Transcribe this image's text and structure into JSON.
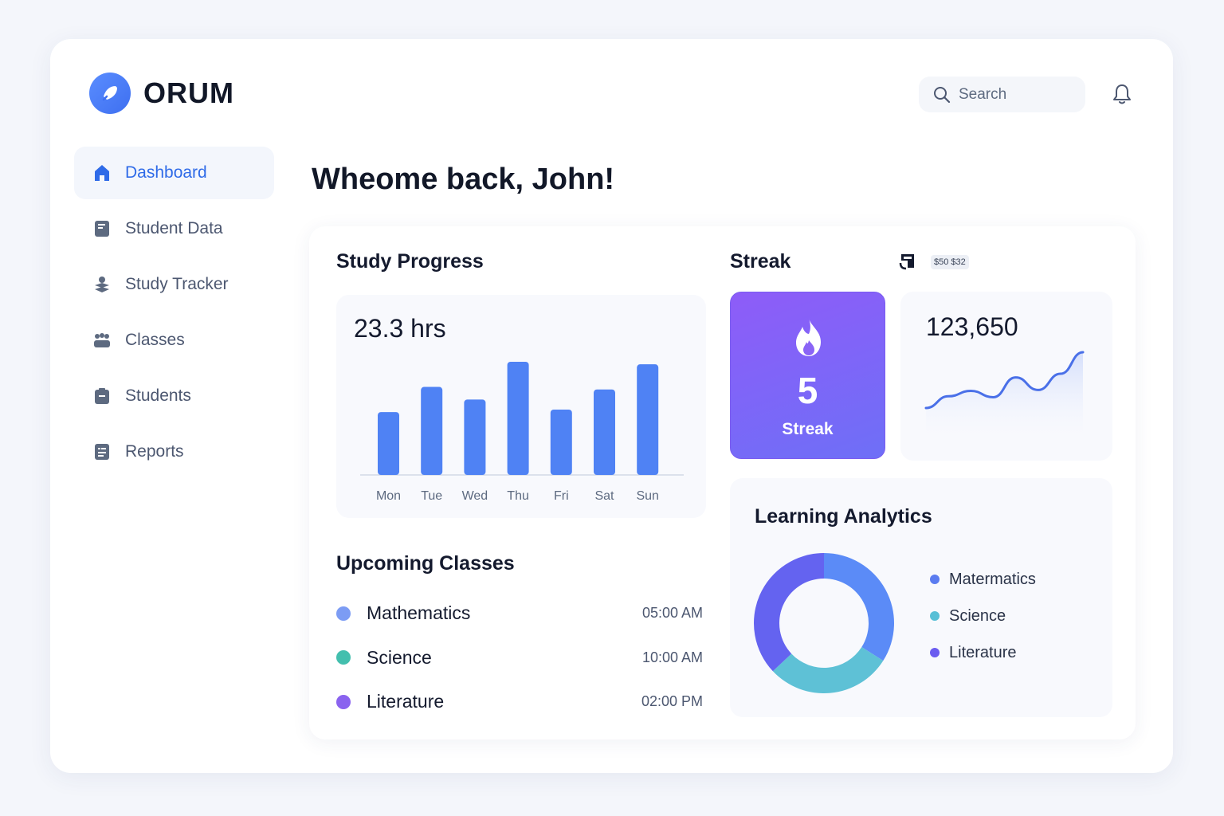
{
  "app": {
    "brand": "ORUM",
    "search_placeholder": "Search",
    "welcome": "Wheome back, John!"
  },
  "sidebar": {
    "items": [
      {
        "label": "Dashboard",
        "icon": "home-icon",
        "active": true
      },
      {
        "label": "Student Data",
        "icon": "book-icon"
      },
      {
        "label": "Study Tracker",
        "icon": "stack-icon"
      },
      {
        "label": "Classes",
        "icon": "group-icon"
      },
      {
        "label": "Students",
        "icon": "clipboard-icon"
      },
      {
        "label": "Reports",
        "icon": "report-icon"
      }
    ]
  },
  "study_progress": {
    "title": "Study Progress",
    "total": "23.3 hrs"
  },
  "upcoming": {
    "title": "Upcoming Classes",
    "classes": [
      {
        "name": "Mathematics",
        "time": "05:00 AM",
        "color": "#7c9cf4"
      },
      {
        "name": "Science",
        "time": "10:00 AM",
        "color": "#43bfae"
      },
      {
        "name": "Literature",
        "time": "02:00 PM",
        "color": "#8a63ef"
      }
    ]
  },
  "streak": {
    "title": "Streak",
    "count": "5",
    "label": "Streak",
    "chip": "$50 $32",
    "stat_value": "123,650"
  },
  "analytics": {
    "title": "Learning Analytics",
    "legend": [
      {
        "label": "Matermatics",
        "color": "#5b7cf0"
      },
      {
        "label": "Science",
        "color": "#58bfd6"
      },
      {
        "label": "Literature",
        "color": "#6b5cf0"
      }
    ]
  },
  "chart_data": [
    {
      "type": "bar",
      "categories": [
        "Mon",
        "Tue",
        "Wed",
        "Thu",
        "Fri",
        "Sat",
        "Sun"
      ],
      "values": [
        2.5,
        3.5,
        3.0,
        4.5,
        2.6,
        3.4,
        4.4
      ],
      "color": "#4f82f4"
    },
    {
      "type": "line",
      "values": [
        0,
        1.3,
        1.9,
        1.2,
        3.4,
        2.0,
        3.8,
        6.2
      ],
      "color": "#4a70e8"
    },
    {
      "type": "pie",
      "categories": [
        "Matermatics",
        "Science",
        "Literature"
      ],
      "values": [
        34,
        29,
        37
      ],
      "colors": [
        "#5b8bf7",
        "#5ec1d6",
        "#6463f0"
      ]
    }
  ]
}
